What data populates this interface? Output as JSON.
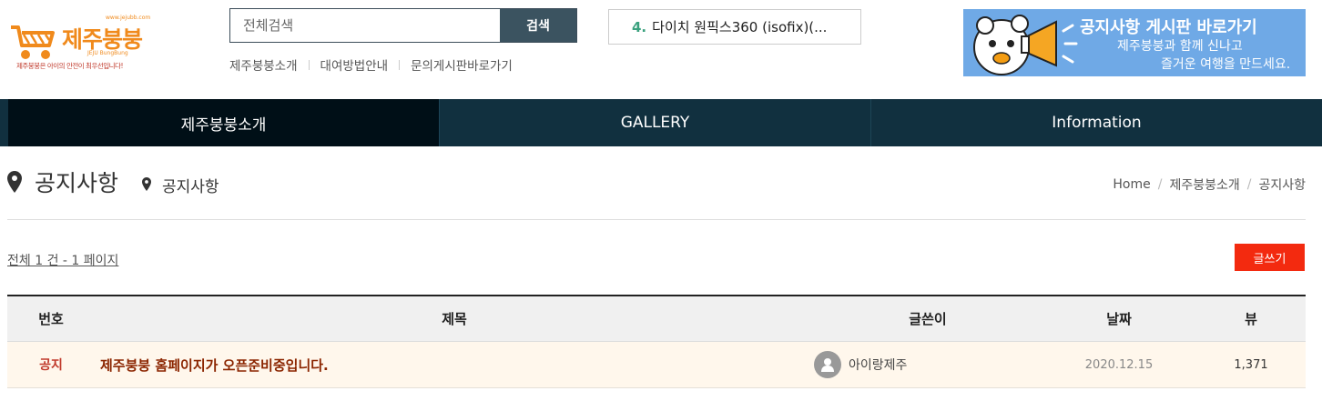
{
  "logo": {
    "url_text": "www.jejubb.com",
    "brand": "제주붕붕",
    "brand_en": "JEJU BungBung",
    "tagline": "제주붕붕은 아이의 안전이 최우선입니다!"
  },
  "search": {
    "placeholder": "전체검색",
    "button_label": "검색"
  },
  "sub_links": [
    "제주붕붕소개",
    "대여방법안내",
    "문의게시판바로가기"
  ],
  "ticker": {
    "number": "4.",
    "text": "다이치 원픽스360 (isofix)(..."
  },
  "banner": {
    "title": "공지사항 게시판 바로가기",
    "line1": "제주붕붕과 함께 신나고",
    "line2": "즐거운 여행을 만드세요."
  },
  "nav": [
    {
      "label": "제주붕붕소개",
      "active": true
    },
    {
      "label": "GALLERY",
      "active": false
    },
    {
      "label": "Information",
      "active": false
    }
  ],
  "page": {
    "title": "공지사항",
    "subtitle": "공지사항",
    "breadcrumb": [
      "Home",
      "제주붕붕소개",
      "공지사항"
    ]
  },
  "list": {
    "count_text": "전체 1 건 - 1 페이지",
    "write_label": "글쓰기",
    "columns": [
      "번호",
      "제목",
      "글쓴이",
      "날짜",
      "뷰"
    ],
    "rows": [
      {
        "num": "공지",
        "subject": "제주붕붕 홈페이지가 오픈준비중입니다.",
        "writer": "아이랑제주",
        "date": "2020.12.15",
        "views": "1,371"
      }
    ]
  },
  "colors": {
    "brand_orange": "#f08a1c",
    "nav_bg": "#11303f",
    "nav_active": "#000f17",
    "write_button": "#f32a0f",
    "notice_row": "#fff7ec",
    "banner_bg": "#6fa9e6"
  }
}
